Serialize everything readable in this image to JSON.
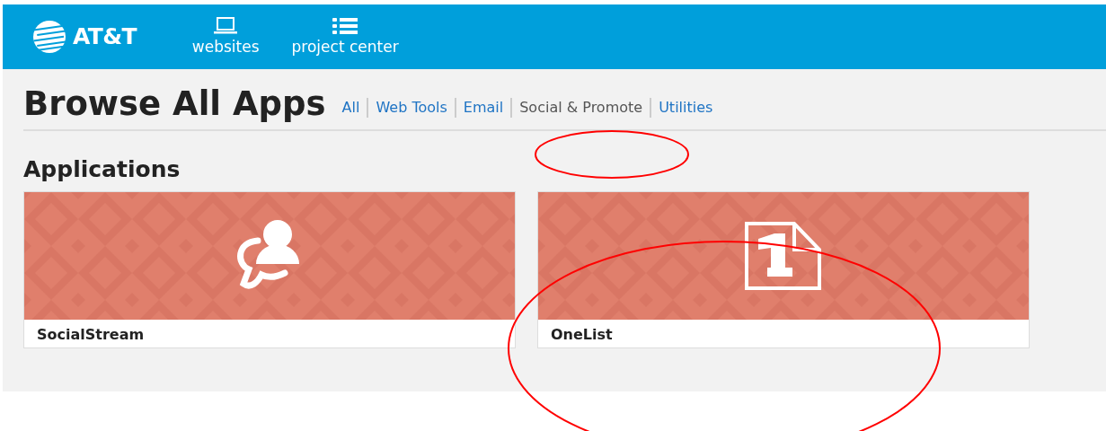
{
  "header": {
    "logo_text": "AT&T",
    "nav": [
      {
        "label": "websites",
        "kind": "laptop"
      },
      {
        "label": "project center",
        "kind": "list"
      }
    ]
  },
  "page": {
    "title": "Browse All Apps",
    "filters": [
      {
        "label": "All",
        "selected": false
      },
      {
        "label": "Web Tools",
        "selected": false
      },
      {
        "label": "Email",
        "selected": false
      },
      {
        "label": "Social & Promote",
        "selected": true
      },
      {
        "label": "Utilities",
        "selected": false
      }
    ]
  },
  "section": {
    "title": "Applications",
    "apps": [
      {
        "name": "SocialStream",
        "kind": "social"
      },
      {
        "name": "OneList",
        "kind": "document"
      }
    ]
  }
}
